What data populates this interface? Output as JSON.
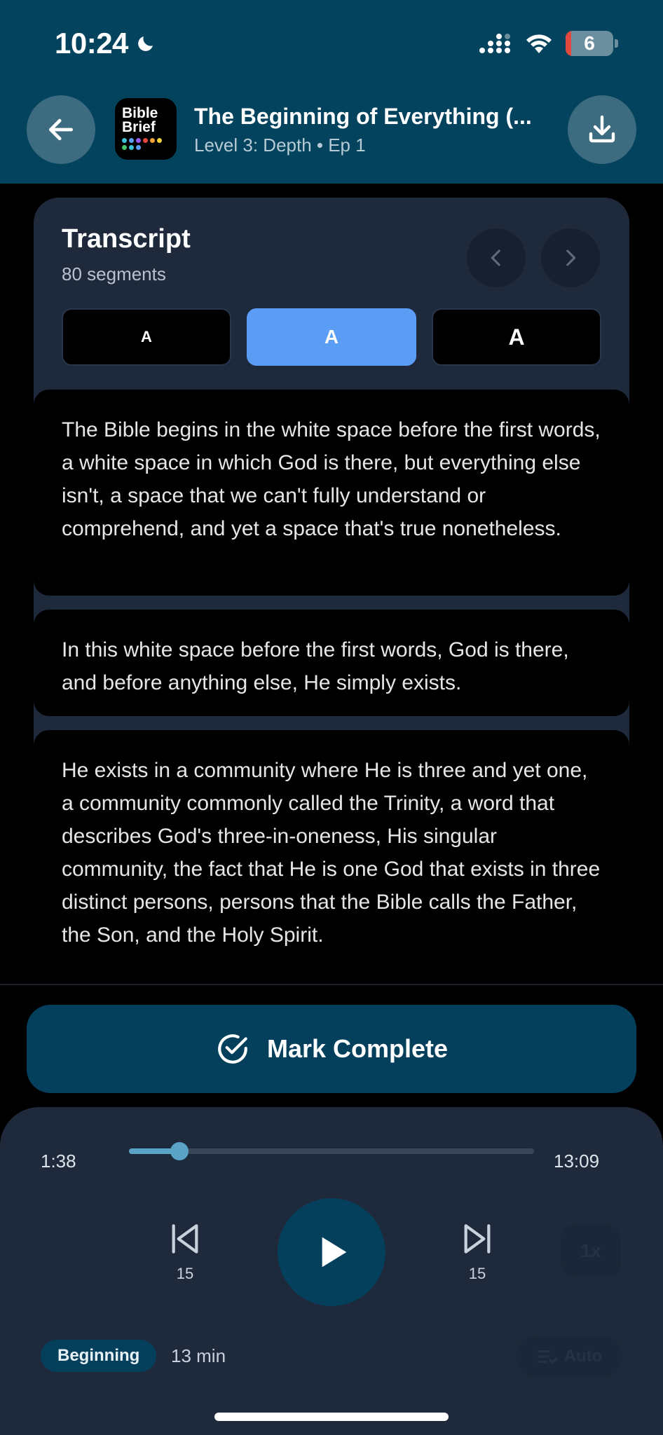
{
  "status_bar": {
    "time": "10:24",
    "battery": "6"
  },
  "header": {
    "app_icon_line1": "Bible",
    "app_icon_line2": "Brief",
    "title": "The Beginning of Everything (...",
    "subtitle": "Level 3: Depth • Ep 1",
    "icons": {
      "back": "arrow-left-icon",
      "download": "download-icon"
    }
  },
  "transcript": {
    "title": "Transcript",
    "count_label": "80 segments",
    "text_sizes": [
      {
        "label": "A",
        "active": false
      },
      {
        "label": "A",
        "active": true
      },
      {
        "label": "A",
        "active": false
      }
    ],
    "segments": [
      "The Bible begins in the white space before the first words, a white space in which God is there, but everything else isn't, a space that we can't fully understand or comprehend, and yet a space that's true nonetheless.",
      "In this white space before the first words, God is there, and before anything else, He simply exists.",
      "He exists in a community where He is three and yet one, a community commonly called the Trinity, a word that describes God's three-in-oneness, His singular community, the fact that He is one God that exists in three distinct persons, persons that the Bible calls the Father, the Son, and the Holy Spirit."
    ]
  },
  "mark_complete": {
    "label": "Mark Complete"
  },
  "player": {
    "elapsed": "1:38",
    "total": "13:09",
    "progress": 0.125,
    "skip_back": "15",
    "skip_forward": "15",
    "speed": "1x",
    "chip": "Beginning",
    "duration": "13 min",
    "auto": "Auto"
  },
  "colors": {
    "header_bg": "#04435e",
    "card_bg": "#1e2a3c",
    "accent_blue": "#5b9df4",
    "button_bg": "#04405c",
    "progress": "#5aa2c6"
  }
}
